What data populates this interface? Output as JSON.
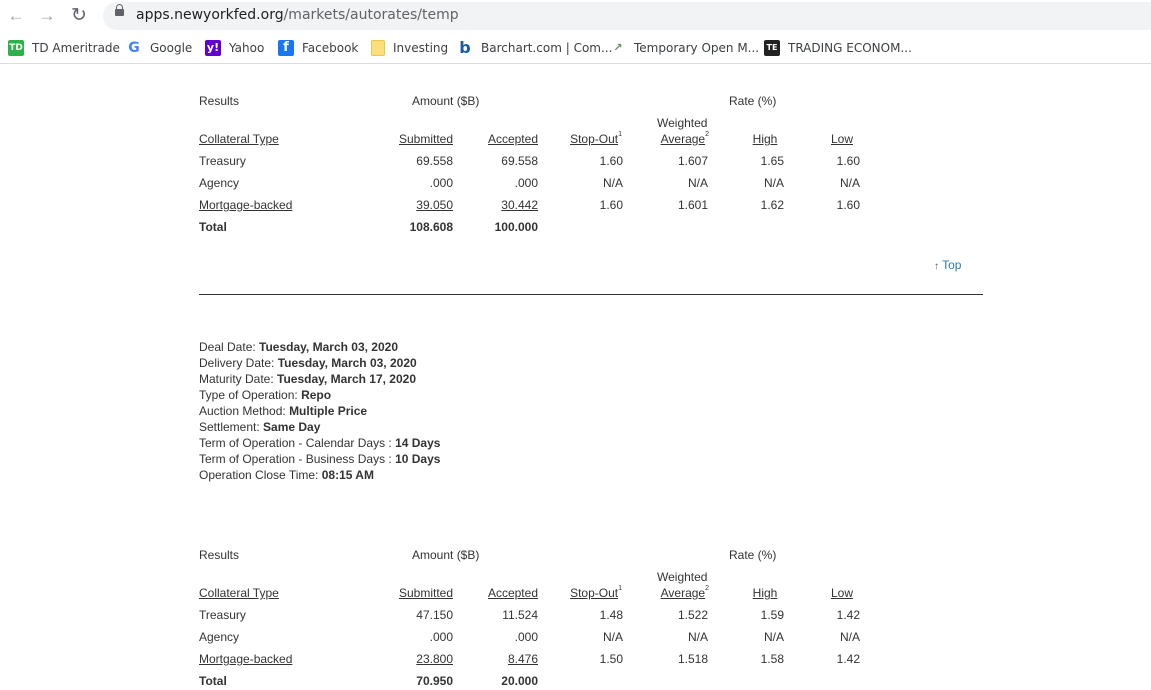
{
  "browser": {
    "url_domain": "apps.newyorkfed.org",
    "url_path": "/markets/autorates/temp",
    "bookmarks": [
      {
        "label": "TD Ameritrade",
        "icon": "td-ameritrade-icon"
      },
      {
        "label": "Google",
        "icon": "google-icon"
      },
      {
        "label": "Yahoo",
        "icon": "yahoo-icon"
      },
      {
        "label": "Facebook",
        "icon": "facebook-icon"
      },
      {
        "label": "Investing",
        "icon": "folder-icon"
      },
      {
        "label": "Barchart.com | Com...",
        "icon": "barchart-icon"
      },
      {
        "label": "Temporary Open M...",
        "icon": "chart-icon"
      },
      {
        "label": "TRADING ECONOM...",
        "icon": "trading-economics-icon"
      }
    ]
  },
  "table1": {
    "results_label": "Results",
    "amount_label": "Amount ($B)",
    "rate_label": "Rate (%)",
    "headers": {
      "collateral": "Collateral Type",
      "submitted": "Submitted",
      "accepted": "Accepted",
      "stopout": "Stop-Out",
      "stopout_sup": "1",
      "weighted_line1": "Weighted",
      "weighted_line2": "Average",
      "weighted_sup": "2",
      "high": "High",
      "low": "Low"
    },
    "rows": [
      {
        "type": "Treasury",
        "submitted": "69.558",
        "accepted": "69.558",
        "stopout": "1.60",
        "weighted": "1.607",
        "high": "1.65",
        "low": "1.60"
      },
      {
        "type": "Agency",
        "submitted": ".000",
        "accepted": ".000",
        "stopout": "N/A",
        "weighted": "N/A",
        "high": "N/A",
        "low": "N/A"
      },
      {
        "type": "Mortgage-backed",
        "submitted": "39.050",
        "accepted": "30.442",
        "stopout": "1.60",
        "weighted": "1.601",
        "high": "1.62",
        "low": "1.60"
      }
    ],
    "total": {
      "label": "Total",
      "submitted": "108.608",
      "accepted": "100.000"
    }
  },
  "top_link": {
    "arrow": "↑",
    "label": "Top"
  },
  "operation": [
    {
      "label": "Deal Date: ",
      "value": "Tuesday, March 03, 2020"
    },
    {
      "label": "Delivery Date: ",
      "value": "Tuesday, March 03, 2020"
    },
    {
      "label": "Maturity Date: ",
      "value": "Tuesday, March 17, 2020"
    },
    {
      "label": "Type of Operation: ",
      "value": "Repo"
    },
    {
      "label": "Auction Method: ",
      "value": "Multiple Price"
    },
    {
      "label": "Settlement: ",
      "value": "Same Day"
    },
    {
      "label": "Term of Operation - Calendar Days : ",
      "value": "14 Days"
    },
    {
      "label": "Term of Operation - Business Days : ",
      "value": "10 Days"
    },
    {
      "label": "Operation Close Time: ",
      "value": "08:15 AM"
    }
  ],
  "table2": {
    "results_label": "Results",
    "amount_label": "Amount ($B)",
    "rate_label": "Rate (%)",
    "headers": {
      "collateral": "Collateral Type",
      "submitted": "Submitted",
      "accepted": "Accepted",
      "stopout": "Stop-Out",
      "stopout_sup": "1",
      "weighted_line1": "Weighted",
      "weighted_line2": "Average",
      "weighted_sup": "2",
      "high": "High",
      "low": "Low"
    },
    "rows": [
      {
        "type": "Treasury",
        "submitted": "47.150",
        "accepted": "11.524",
        "stopout": "1.48",
        "weighted": "1.522",
        "high": "1.59",
        "low": "1.42"
      },
      {
        "type": "Agency",
        "submitted": ".000",
        "accepted": ".000",
        "stopout": "N/A",
        "weighted": "N/A",
        "high": "N/A",
        "low": "N/A"
      },
      {
        "type": "Mortgage-backed",
        "submitted": "23.800",
        "accepted": "8.476",
        "stopout": "1.50",
        "weighted": "1.518",
        "high": "1.58",
        "low": "1.42"
      }
    ],
    "total": {
      "label": "Total",
      "submitted": "70.950",
      "accepted": "20.000"
    }
  }
}
